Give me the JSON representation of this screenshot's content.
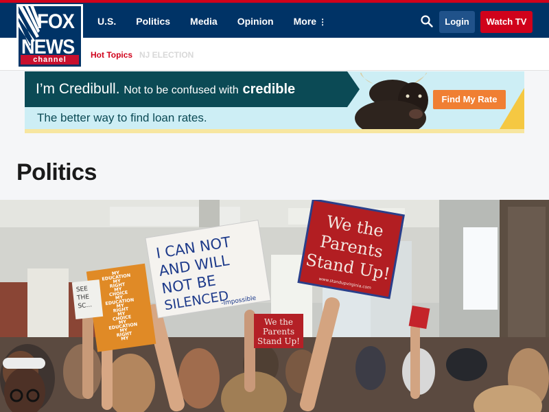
{
  "header": {
    "logo": {
      "line1": "FOX",
      "line2": "NEWS",
      "line3": "channel"
    },
    "nav": [
      "U.S.",
      "Politics",
      "Media",
      "Opinion",
      "More"
    ],
    "more_dots": "⋮",
    "login_label": "Login",
    "watch_label": "Watch TV"
  },
  "subnav": {
    "hot_topics": "Hot Topics",
    "items": [
      "NJ ELECTION"
    ]
  },
  "ad": {
    "headline_a": "I’m Credibull.",
    "headline_b": "Not to be confused with",
    "headline_c": "credible",
    "subline": "The better way to find loan rates.",
    "cta": "Find My Rate"
  },
  "page": {
    "title": "Politics"
  },
  "hero": {
    "sign_1": [
      "I CAN NOT",
      "AND WILL",
      "NOT BE",
      "SILENCED"
    ],
    "sign_1_note": "-Impossible",
    "sign_2": [
      "We the",
      "Parents",
      "Stand Up!"
    ],
    "sign_2_url": "www.standupvirginia.com",
    "sign_3": [
      "We the",
      "Parents",
      "Stand Up!"
    ],
    "sign_4": [
      "MY",
      "EDUCATION",
      "MY",
      "RIGHT",
      "MY",
      "CHOICE",
      "MY",
      "EDUCATION",
      "MY",
      "RIGHT",
      "MY",
      "CHOICE",
      "MY",
      "EDUCATION",
      "MY",
      "RIGHT",
      "MY"
    ],
    "sign_5": [
      "SEE",
      "THE",
      "SC..."
    ]
  },
  "colors": {
    "navy": "#003366",
    "red": "#d0021b",
    "login_bg": "#20528a",
    "ad_teal": "#0b4a55",
    "ad_orange": "#f07f33"
  }
}
